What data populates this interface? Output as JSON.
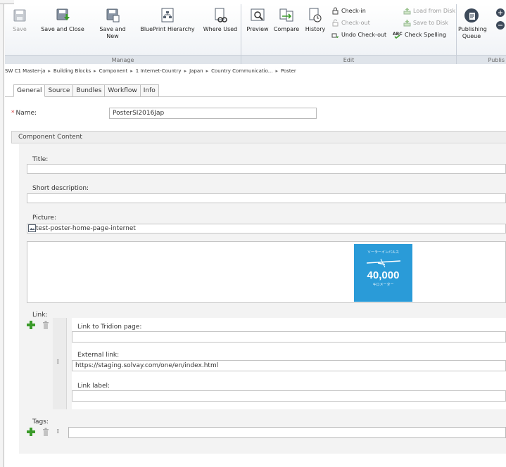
{
  "ribbon": {
    "groups": {
      "manage": "Manage",
      "edit": "Edit",
      "publish": "Publis"
    },
    "buttons": {
      "save": "Save",
      "save_and_close": "Save and Close",
      "save_and_new_l1": "Save and",
      "save_and_new_l2": "New",
      "blueprint_hierarchy": "BluePrint Hierarchy",
      "where_used": "Where Used",
      "preview": "Preview",
      "compare": "Compare",
      "history": "History",
      "check_in": "Check-in",
      "check_out": "Check-out",
      "undo_check_out": "Undo Check-out",
      "load_from_disk": "Load from Disk",
      "save_to_disk": "Save to Disk",
      "check_spelling": "Check Spelling",
      "publishing_queue_l1": "Publishing",
      "publishing_queue_l2": "Queue"
    }
  },
  "breadcrumb": [
    "SW C1 Master-ja",
    "Building Blocks",
    "Component",
    "1 Internet-Country",
    "Japan",
    "Country Communicatio...",
    "Poster"
  ],
  "tabs": [
    "General",
    "Source",
    "Bundles",
    "Workflow",
    "Info"
  ],
  "active_tab": "General",
  "form": {
    "name_label": "Name:",
    "name_value": "PosterSI2016Jap",
    "section_title": "Component Content",
    "title_label": "Title:",
    "title_value": "",
    "short_desc_label": "Short description:",
    "short_desc_value": "",
    "picture_label": "Picture:",
    "picture_value": "test-poster-home-page-internet",
    "poster": {
      "top_text": "ソーラーインパルス",
      "number": "40,000",
      "bottom_text": "キロメーター"
    },
    "link_label": "Link:",
    "link_tridion_label": "Link to Tridion page:",
    "link_tridion_value": "",
    "external_link_label": "External link:",
    "external_link_value": "https://staging.solvay.com/one/en/index.html",
    "link_label_label": "Link label:",
    "link_label_value": "",
    "tags_label": "Tags:",
    "tags_value": ""
  },
  "colors": {
    "accent_green": "#3b9b2a",
    "required_red": "#d23b3b",
    "poster_blue": "#2a9bd8"
  }
}
